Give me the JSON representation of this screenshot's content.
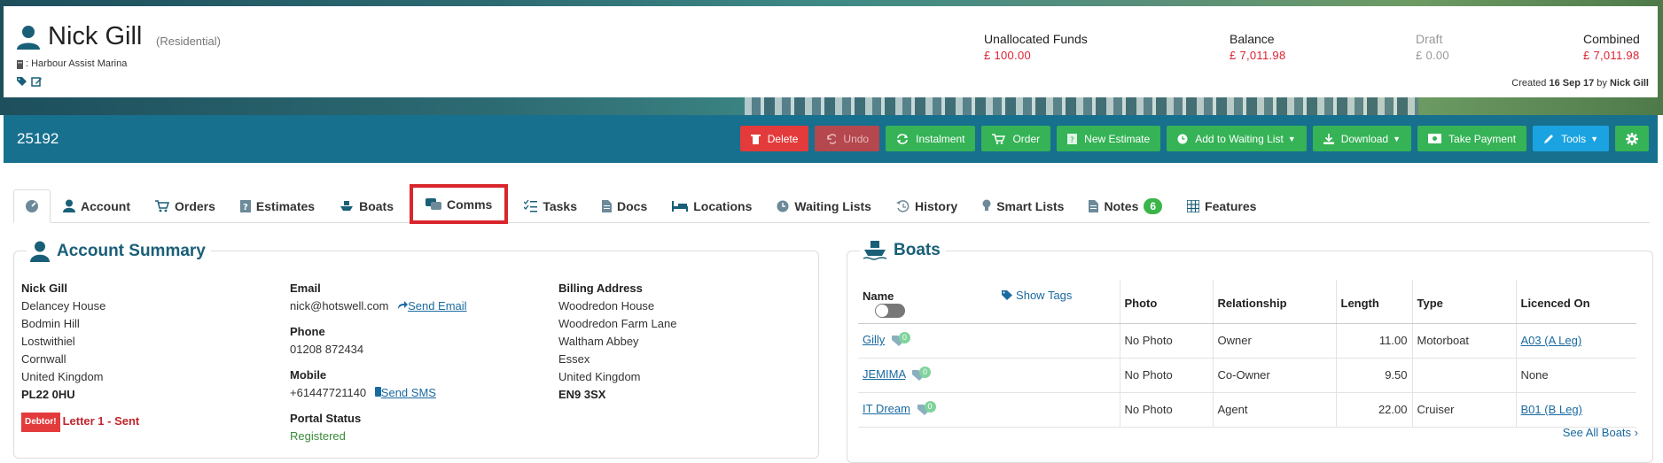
{
  "customer": {
    "name": "Nick Gill",
    "type": "(Residential)",
    "marina": ": Harbour Assist Marina"
  },
  "funds": [
    {
      "label": "Unallocated Funds",
      "value": "£ 100.00"
    },
    {
      "label": "Balance",
      "value": "£ 7,011.98"
    },
    {
      "label": "Draft",
      "value": "£ 0.00"
    },
    {
      "label": "Combined",
      "value": "£ 7,011.98"
    }
  ],
  "created": {
    "prefix": "Created",
    "date": "16 Sep 17",
    "by_word": "by",
    "by": "Nick Gill"
  },
  "account_number": "25192",
  "toolbar": {
    "delete": "Delete",
    "undo": "Undo",
    "instalment": "Instalment",
    "order": "Order",
    "new_estimate": "New Estimate",
    "waiting_list": "Add to Waiting List",
    "download": "Download",
    "take_payment": "Take Payment",
    "tools": "Tools"
  },
  "tabs": {
    "account": "Account",
    "orders": "Orders",
    "estimates": "Estimates",
    "boats": "Boats",
    "comms": "Comms",
    "tasks": "Tasks",
    "docs": "Docs",
    "locations": "Locations",
    "waiting_lists": "Waiting Lists",
    "history": "History",
    "smart_lists": "Smart Lists",
    "notes": "Notes",
    "notes_count": "6",
    "features": "Features"
  },
  "account_summary": {
    "title": "Account Summary",
    "address": [
      "Nick Gill",
      "Delancey House",
      "Bodmin Hill",
      "Lostwithiel",
      "Cornwall",
      "United Kingdom",
      "PL22 0HU"
    ],
    "debtor_badge": "Debtor!",
    "letter_status": "Letter 1 - Sent",
    "email_label": "Email",
    "email": "nick@hotswell.com",
    "send_email": "Send Email",
    "phone_label": "Phone",
    "phone": "01208 872434",
    "mobile_label": "Mobile",
    "mobile": "+61447721140",
    "send_sms": "Send SMS",
    "portal_label": "Portal Status",
    "portal_status": "Registered",
    "billing_label": "Billing Address",
    "billing": [
      "Woodredon House",
      "Woodredon Farm Lane",
      "Waltham Abbey",
      "Essex",
      "United Kingdom",
      "EN9 3SX"
    ]
  },
  "boats": {
    "title": "Boats",
    "show_tags": "Show Tags",
    "headers": [
      "Name",
      "Photo",
      "Relationship",
      "Length",
      "Type",
      "Licenced On"
    ],
    "rows": [
      {
        "name": "Gilly",
        "tags": "0",
        "photo": "No Photo",
        "relationship": "Owner",
        "length": "11.00",
        "type": "Motorboat",
        "licenced": "A03 (A Leg)"
      },
      {
        "name": "JEMIMA",
        "tags": "0",
        "photo": "No Photo",
        "relationship": "Co-Owner",
        "length": "9.50",
        "type": "",
        "licenced": "None"
      },
      {
        "name": "IT Dream",
        "tags": "0",
        "photo": "No Photo",
        "relationship": "Agent",
        "length": "22.00",
        "type": "Cruiser",
        "licenced": "B01 (B Leg)"
      }
    ],
    "see_all": "See All Boats"
  }
}
